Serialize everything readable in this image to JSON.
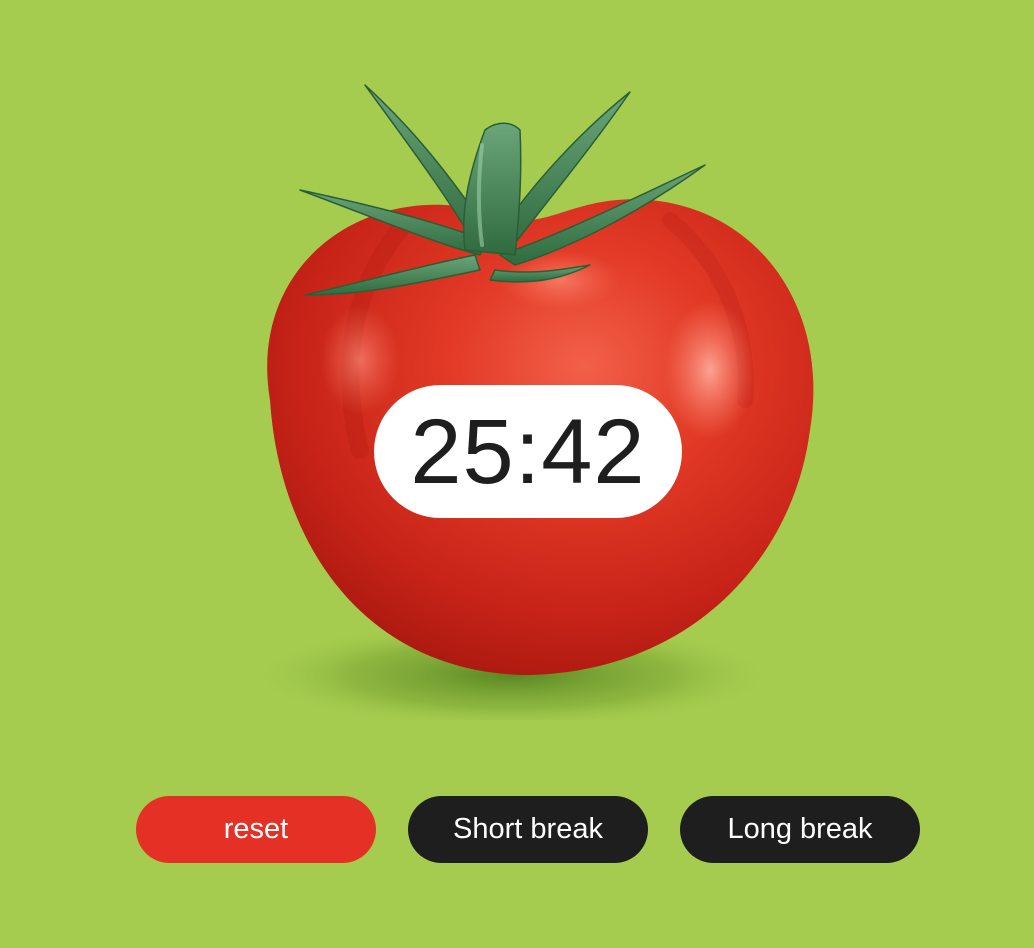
{
  "colors": {
    "background": "#a5cc4e",
    "reset_button": "#e53125",
    "dark_button": "#1e1e1e",
    "timer_background": "#ffffff",
    "timer_text": "#1e1e1e",
    "button_text": "#ffffff"
  },
  "tomato": {
    "icon": "tomato-image"
  },
  "timer": {
    "display": "25:42"
  },
  "controls": {
    "reset_label": "reset",
    "short_break_label": "Short break",
    "long_break_label": "Long break"
  }
}
